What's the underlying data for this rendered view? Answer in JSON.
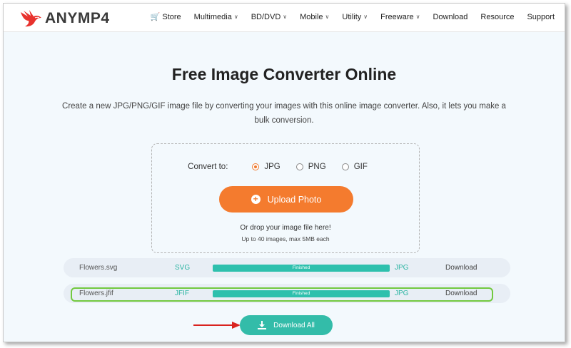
{
  "brand": {
    "name": "ANYMP4",
    "logo_icon": "phoenix-logo-icon",
    "logo_color": "#e8322d"
  },
  "nav": {
    "items": [
      {
        "label": "Store",
        "icon": "cart-icon",
        "dropdown": false
      },
      {
        "label": "Multimedia",
        "dropdown": true
      },
      {
        "label": "BD/DVD",
        "dropdown": true
      },
      {
        "label": "Mobile",
        "dropdown": true
      },
      {
        "label": "Utility",
        "dropdown": true
      },
      {
        "label": "Freeware",
        "dropdown": true
      },
      {
        "label": "Download",
        "dropdown": false
      },
      {
        "label": "Resource",
        "dropdown": false
      },
      {
        "label": "Support",
        "dropdown": false
      }
    ]
  },
  "hero": {
    "title": "Free Image Converter Online",
    "subtitle": "Create a new JPG/PNG/GIF image file by converting your images with this online image converter. Also, it lets you make a bulk conversion."
  },
  "converter": {
    "convert_label": "Convert to:",
    "formats": [
      {
        "label": "JPG",
        "selected": true
      },
      {
        "label": "PNG",
        "selected": false
      },
      {
        "label": "GIF",
        "selected": false
      }
    ],
    "upload_label": "Upload Photo",
    "drop_text": "Or drop your image file here!",
    "limit_text": "Up to 40 images, max 5MB each"
  },
  "files": [
    {
      "name": "Flowers.svg",
      "from": "SVG",
      "status": "Finished",
      "progress": 1.0,
      "to": "JPG",
      "action": "Download"
    },
    {
      "name": "Flowers.jfif",
      "from": "JFIF",
      "status": "Finished",
      "progress": 1.0,
      "to": "JPG",
      "action": "Download"
    }
  ],
  "download_all": {
    "label": "Download All",
    "icon": "download-icon"
  },
  "colors": {
    "accent_orange": "#f47b2e",
    "accent_teal": "#33bca9",
    "highlight_green": "#72c93f",
    "arrow_red": "#d9231f"
  }
}
